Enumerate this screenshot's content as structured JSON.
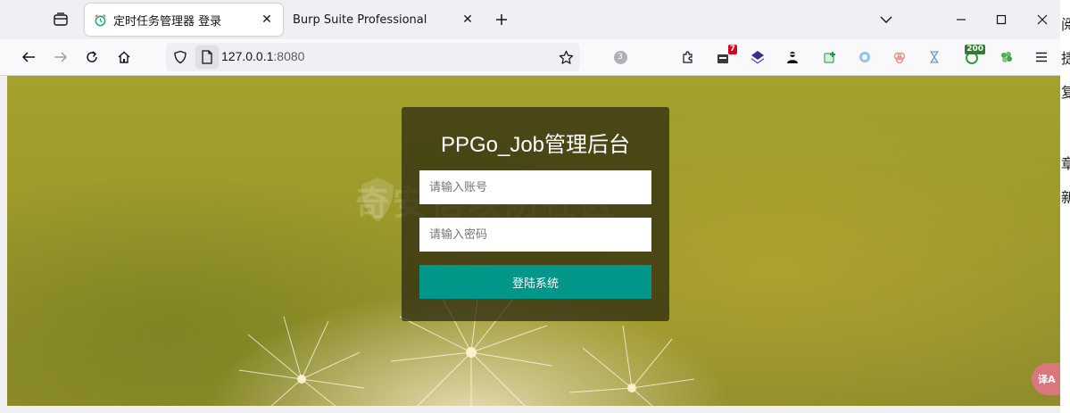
{
  "browser": {
    "tabs": [
      {
        "title": "定时任务管理器 登录",
        "icon": "alarm-clock-icon",
        "active": true
      },
      {
        "title": "Burp Suite Professional",
        "icon": "",
        "active": false
      }
    ],
    "url_host": "127.0.0.1",
    "url_port": ":8080",
    "extensions": [
      {
        "name": "extension-badge-icon",
        "badge": "7",
        "badge_color": "#d70022"
      },
      {
        "name": "extension-200-icon",
        "badge": "200",
        "badge_color": "#2e7d32"
      }
    ],
    "tracking_count": "3"
  },
  "page": {
    "title": "PPGo_Job管理后台",
    "username_placeholder": "请输入账号",
    "password_placeholder": "请输入密码",
    "login_button": "登陆系统",
    "watermark": "奇安信攻防社区",
    "accent_color": "#009688",
    "translate_label": "译A"
  },
  "edge_glyphs": [
    "阅",
    "捷",
    "复",
    "章",
    "新"
  ]
}
